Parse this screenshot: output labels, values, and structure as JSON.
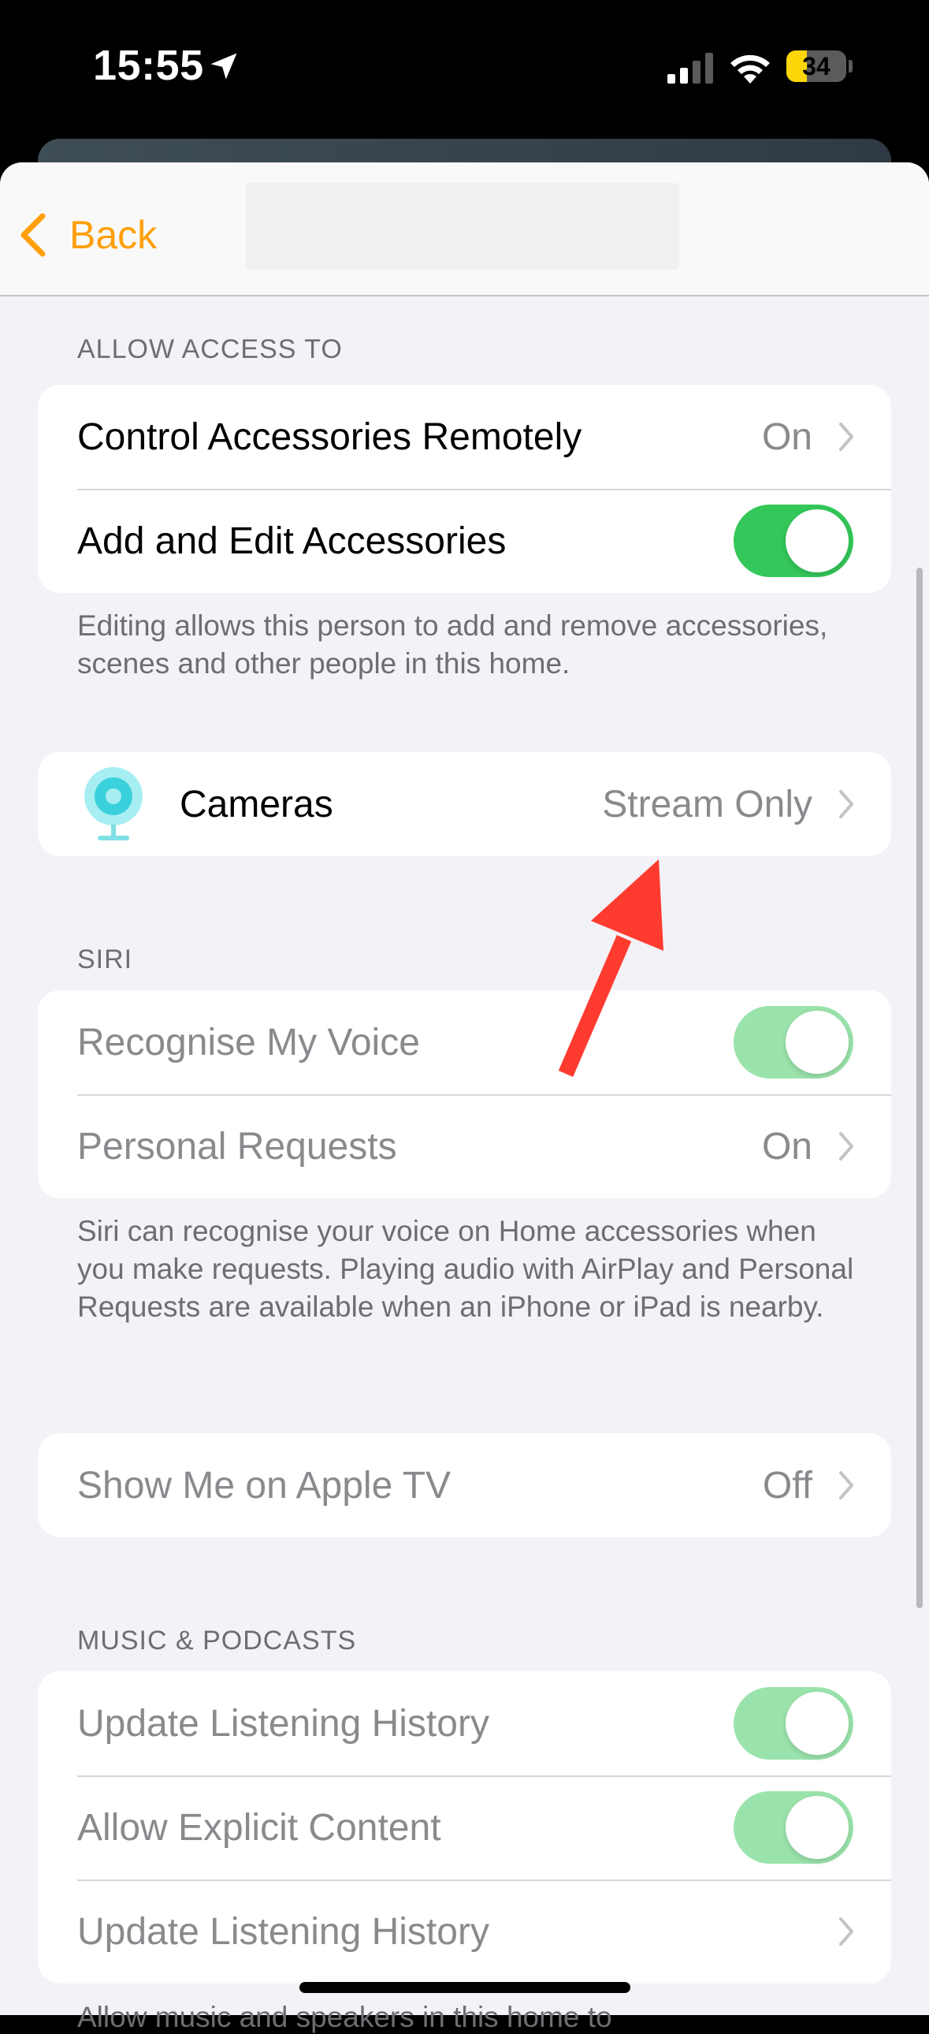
{
  "status_bar": {
    "time": "15:55",
    "battery": "34",
    "battery_level": 0.34,
    "location_icon": "location-arrow-icon",
    "signal_icon": "cellular-signal-icon",
    "wifi_icon": "wifi-icon"
  },
  "nav": {
    "back_label": "Back",
    "back_icon": "chevron-left-icon"
  },
  "sections": {
    "allow_access": {
      "header": "ALLOW ACCESS TO",
      "rows": [
        {
          "label": "Control Accessories Remotely",
          "value": "On"
        },
        {
          "label": "Add and Edit Accessories",
          "toggle": true
        }
      ],
      "footer": "Editing allows this person to add and remove accessories, scenes and other people in this home."
    },
    "cameras": {
      "label": "Cameras",
      "value": "Stream Only",
      "icon": "camera-icon"
    },
    "siri": {
      "header": "SIRI",
      "rows": [
        {
          "label": "Recognise My Voice",
          "toggle": true
        },
        {
          "label": "Personal Requests",
          "value": "On"
        }
      ],
      "footer": "Siri can recognise your voice on Home accessories when you make requests. Playing audio with AirPlay and Personal Requests are available when an iPhone or iPad is nearby."
    },
    "apple_tv": {
      "label": "Show Me on Apple TV",
      "value": "Off"
    },
    "music": {
      "header": "MUSIC & PODCASTS",
      "rows": [
        {
          "label": "Update Listening History",
          "toggle": true
        },
        {
          "label": "Allow Explicit Content",
          "toggle": true
        },
        {
          "label": "Update Listening History"
        }
      ],
      "footer_partial": "Allow music and speakers in this home to"
    }
  },
  "colors": {
    "accent": "#ff9f0a",
    "toggle_on": "#34c759",
    "toggle_on_dim": "#9be3ac",
    "annotation": "#ff3b30"
  }
}
